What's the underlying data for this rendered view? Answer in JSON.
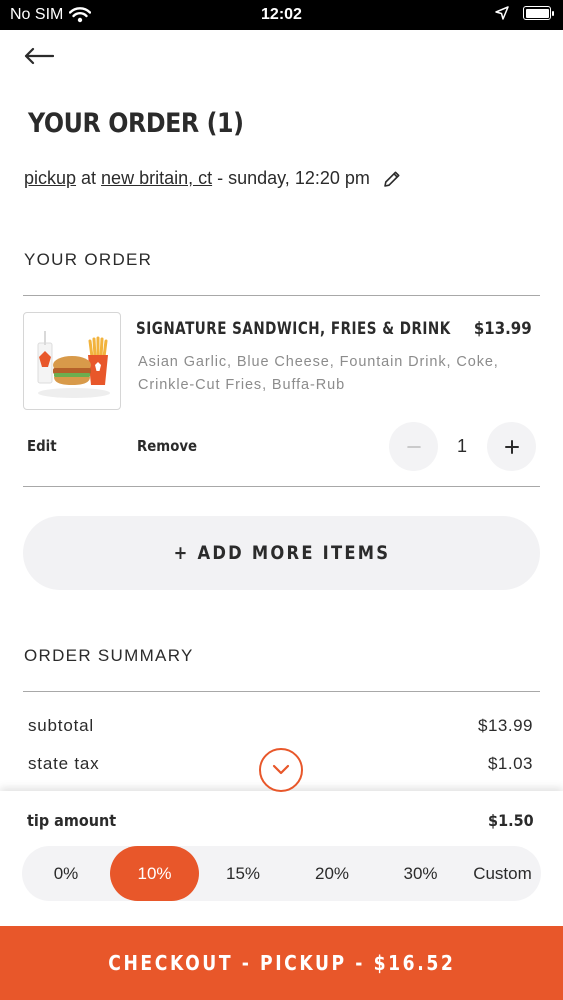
{
  "status_bar": {
    "carrier": "No SIM",
    "time": "12:02",
    "icons": [
      "wifi-icon",
      "location-arrow-icon",
      "battery-icon"
    ]
  },
  "header": {
    "back_icon": "arrow-left-icon",
    "title": "YOUR ORDER (1)"
  },
  "pickup": {
    "mode": "pickup",
    "at": "at",
    "location": "new britain, ct",
    "time": "- sunday, 12:20 pm",
    "edit_icon": "pencil-icon"
  },
  "order": {
    "section_label": "YOUR ORDER",
    "items": [
      {
        "name": "SIGNATURE SANDWICH, FRIES & DRINK",
        "price": "$13.99",
        "description": "Asian Garlic, Blue Cheese, Fountain Drink, Coke, Crinkle-Cut Fries, Buffa-Rub",
        "edit_label": "Edit",
        "remove_label": "Remove",
        "quantity": "1",
        "minus_icon": "minus-icon",
        "plus_icon": "plus-icon"
      }
    ],
    "add_more_label": "+ ADD MORE ITEMS"
  },
  "summary": {
    "section_label": "ORDER SUMMARY",
    "rows": [
      {
        "label": "subtotal",
        "value": "$13.99"
      },
      {
        "label": "state tax",
        "value": "$1.03"
      }
    ],
    "collapse_icon": "chevron-down-icon"
  },
  "tip": {
    "label": "tip amount",
    "value": "$1.50",
    "options": [
      "0%",
      "10%",
      "15%",
      "20%",
      "30%",
      "Custom"
    ],
    "selected": "10%"
  },
  "checkout": {
    "label": "CHECKOUT - PICKUP - $16.52"
  },
  "colors": {
    "accent": "#e8572a",
    "text": "#2b2b2b",
    "muted": "#8c8c8c",
    "pill_bg": "#f2f2f4"
  }
}
